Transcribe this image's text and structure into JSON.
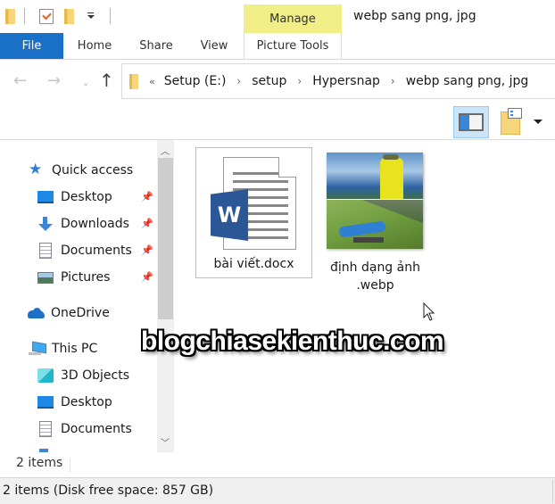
{
  "window": {
    "title": "webp sang png, jpg",
    "context_tab": "Manage"
  },
  "quick_access_toolbar": {
    "icons": [
      "folder-icon",
      "properties-icon",
      "new-folder-icon",
      "customize-dropdown-icon"
    ]
  },
  "ribbon": {
    "tabs": [
      {
        "label": "File",
        "active": true
      },
      {
        "label": "Home"
      },
      {
        "label": "Share"
      },
      {
        "label": "View"
      },
      {
        "label": "Picture Tools"
      }
    ]
  },
  "navigation": {
    "back": "←",
    "forward": "→",
    "recent": "⌄",
    "up": "↑"
  },
  "address_bar": {
    "overflow": "«",
    "separator": "›",
    "crumbs": [
      "Setup (E:)",
      "setup",
      "Hypersnap",
      "webp sang png, jpg"
    ]
  },
  "view_toolbar": {
    "preview_pane_active": true,
    "options_dropdown": "▾"
  },
  "nav_pane": {
    "items": [
      {
        "label": "Quick access",
        "icon": "star-icon",
        "pinned": false
      },
      {
        "label": "Desktop",
        "icon": "desktop-icon",
        "pinned": true
      },
      {
        "label": "Downloads",
        "icon": "downloads-icon",
        "pinned": true
      },
      {
        "label": "Documents",
        "icon": "documents-icon",
        "pinned": true
      },
      {
        "label": "Pictures",
        "icon": "pictures-icon",
        "pinned": true
      },
      {
        "label": "OneDrive",
        "icon": "onedrive-icon",
        "pinned": false
      },
      {
        "label": "This PC",
        "icon": "this-pc-icon",
        "pinned": false
      },
      {
        "label": "3D Objects",
        "icon": "3d-objects-icon",
        "pinned": false
      },
      {
        "label": "Desktop",
        "icon": "desktop-icon",
        "pinned": false
      },
      {
        "label": "Documents",
        "icon": "documents-icon",
        "pinned": false
      }
    ],
    "pin_glyph": "📌",
    "scroll_up": "︿",
    "scroll_down": "﹀"
  },
  "files": [
    {
      "name": "bài viết.docx",
      "type": "word-document",
      "selected": true,
      "badge": "W"
    },
    {
      "name": "định dạng ảnh\n.webp",
      "name_line1": "định dạng ảnh",
      "name_line2": ".webp",
      "type": "webp-image",
      "selected": false
    }
  ],
  "watermark": "blogchiasekienthuc.com",
  "item_count": "2 items",
  "status_bar": {
    "text": "2 items (Disk free space: 857 GB)"
  }
}
